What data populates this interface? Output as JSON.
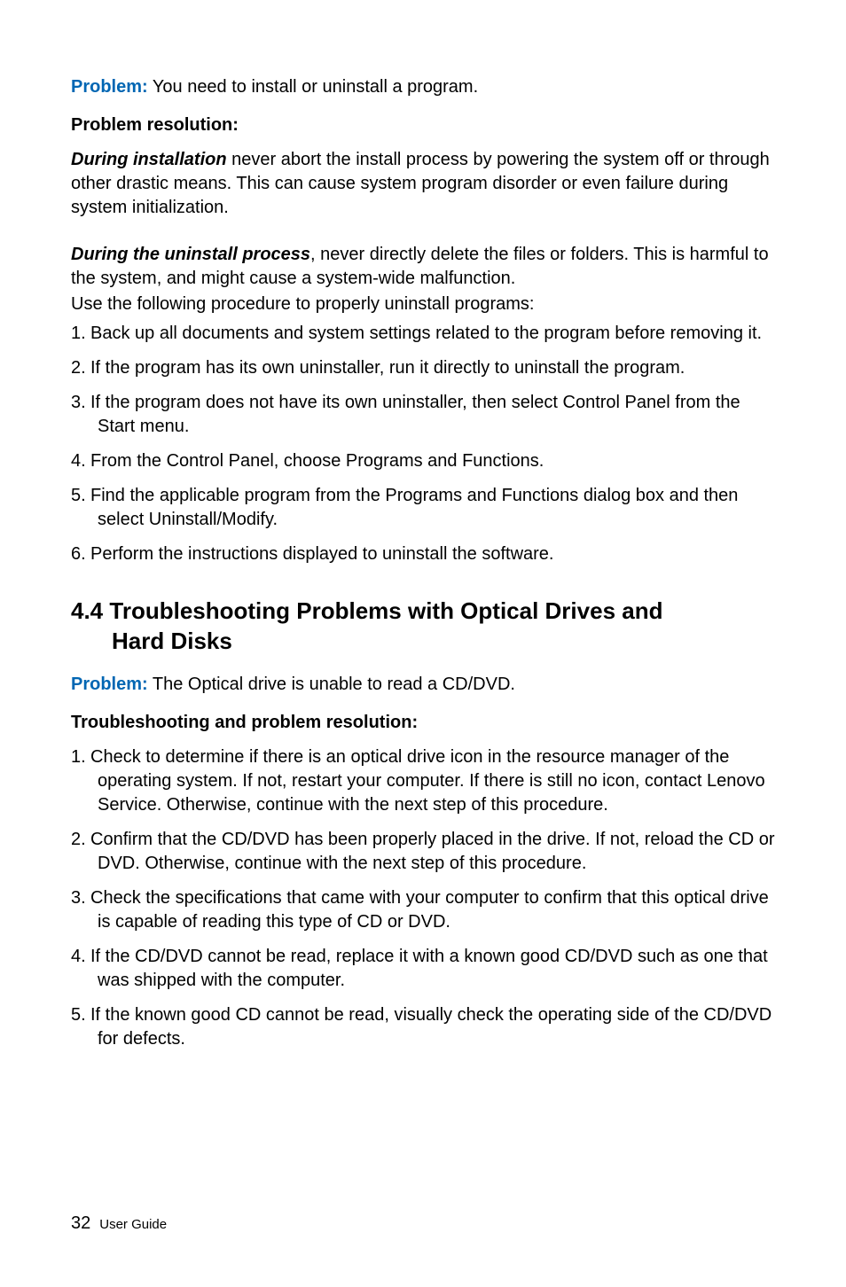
{
  "p1_label": "Problem:",
  "p1_text": " You need to install or uninstall a program.",
  "res_head": "Problem resolution:",
  "install_bold": "During installation",
  "install_text": " never abort the install process by powering the system off or through other drastic means. This can cause system program disorder or even failure during system initialization.",
  "uninstall_bold": "During the uninstall process",
  "uninstall_text": ", never directly delete the files or folders. This is harmful to the system, and might cause a system-wide malfunction.",
  "uninstall_proc": "Use the following procedure to properly uninstall programs:",
  "list1": [
    "Back up all documents and system settings related to the program before removing it.",
    "If the program has its own uninstaller, run it directly to uninstall the program.",
    "If the program does not have its own uninstaller, then select Control Panel from the Start menu.",
    "From the Control Panel, choose Programs and Functions.",
    "Find the applicable program from the Programs and Functions dialog box and then select Uninstall/Modify.",
    "Perform the instructions displayed to uninstall the software."
  ],
  "sec_num": "4.4",
  "sec_title_l1": "Troubleshooting Problems with Optical Drives and",
  "sec_title_l2": "Hard Disks",
  "p2_label": "Problem:",
  "p2_text": " The Optical drive is unable to read a CD/DVD.",
  "ts_head": "Troubleshooting and problem resolution:",
  "list2": [
    "Check to determine if there is an optical drive icon in the resource manager of the operating system. If not, restart your computer. If there is still no icon, contact Lenovo Service. Otherwise, continue with the next step of this procedure.",
    "Confirm that the CD/DVD has been properly placed in the drive. If not, reload the CD or DVD. Otherwise, continue with the next step of this procedure.",
    "Check the specifications that came with your computer to confirm that this optical drive is capable of reading this type of CD or DVD.",
    "If the CD/DVD cannot be read, replace it with a known good CD/DVD such as one that was shipped with the computer.",
    "If the known good CD cannot be read, visually check the operating side of the CD/DVD for defects."
  ],
  "footer_page": "32",
  "footer_label": "User Guide"
}
